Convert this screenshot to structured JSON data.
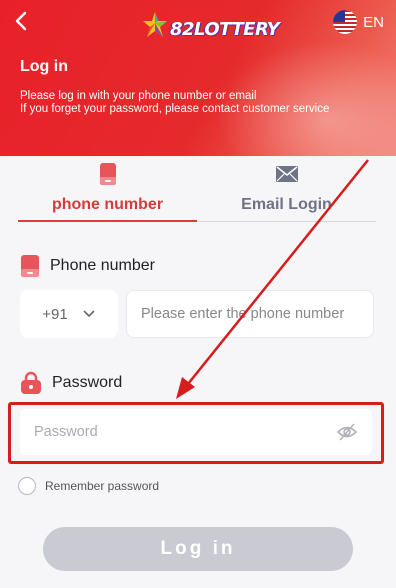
{
  "header": {
    "back_icon": "chevron-left-icon",
    "brand": "82LOTTERY",
    "language": "EN",
    "title": "Log in",
    "description_line1": "Please log in with your phone number or email",
    "description_line2": "If you forget your password, please contact customer service",
    "accent_color": "#e8202a"
  },
  "tabs": [
    {
      "label": "phone number",
      "icon": "phone-icon",
      "active": true
    },
    {
      "label": "Email Login",
      "icon": "envelope-icon",
      "active": false
    }
  ],
  "phone": {
    "label": "Phone number",
    "country_code": "+91",
    "placeholder": "Please enter the phone number"
  },
  "password": {
    "label": "Password",
    "placeholder": "Password",
    "visibility_icon": "eye-off-icon"
  },
  "remember": {
    "label": "Remember password",
    "checked": false
  },
  "login_button": {
    "label": "Log in"
  },
  "annotation": {
    "highlight_color": "#d71c1c"
  }
}
